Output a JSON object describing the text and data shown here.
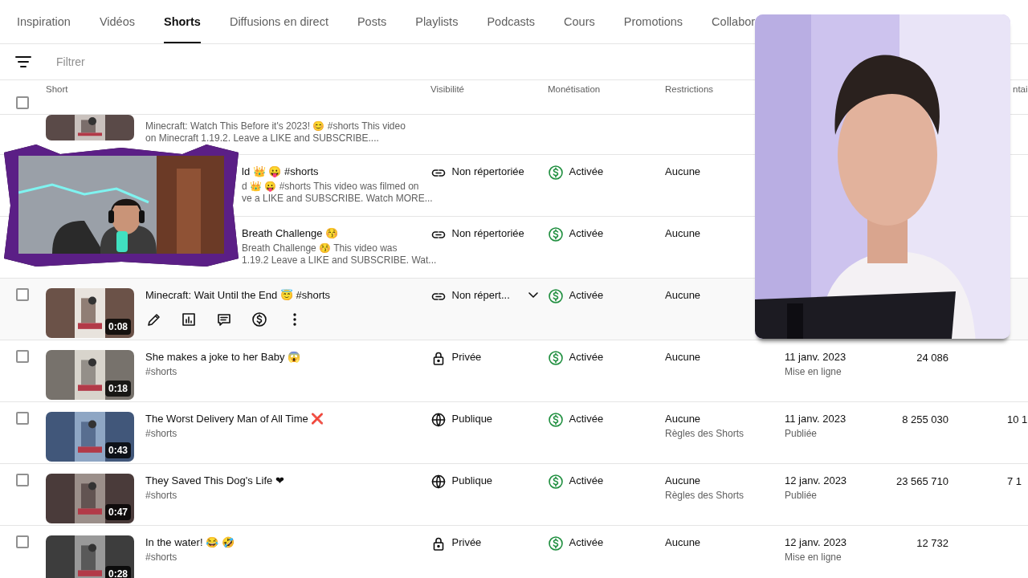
{
  "tabs": [
    {
      "label": "Inspiration",
      "selected": false
    },
    {
      "label": "Vidéos",
      "selected": false
    },
    {
      "label": "Shorts",
      "selected": true
    },
    {
      "label": "Diffusions en direct",
      "selected": false
    },
    {
      "label": "Posts",
      "selected": false
    },
    {
      "label": "Playlists",
      "selected": false
    },
    {
      "label": "Podcasts",
      "selected": false
    },
    {
      "label": "Cours",
      "selected": false
    },
    {
      "label": "Promotions",
      "selected": false
    },
    {
      "label": "Collabor",
      "selected": false
    }
  ],
  "filter": {
    "placeholder": "Filtrer"
  },
  "table": {
    "header": {
      "checked": false,
      "columns": [
        "Short",
        "Visibilité",
        "Monétisation",
        "Restrictions",
        "ntai"
      ]
    },
    "rows": [
      {
        "kind": "clipped",
        "description_lines": [
          "Minecraft: Watch This Before it's 2023! 😊 #shorts This video",
          "on Minecraft 1.19.2. Leave a LIKE and SUBSCRIBE...."
        ]
      },
      {
        "kind": "covered",
        "title": "ld 👑 😛 #shorts",
        "description_lines": [
          "d 👑 😛 #shorts This video was filmed on",
          "ve a LIKE and SUBSCRIBE. Watch MORE..."
        ],
        "visibility": {
          "kind": "unlisted",
          "label": "Non répertoriée"
        },
        "monetization": "Activée",
        "restrictions": "Aucune"
      },
      {
        "kind": "covered",
        "title": "Breath Challenge 😚",
        "description_lines": [
          "Breath Challenge 😚 This video was",
          "1.19.2 Leave a LIKE and SUBSCRIBE. Wat..."
        ],
        "visibility": {
          "kind": "unlisted",
          "label": "Non répertoriée"
        },
        "monetization": "Activée",
        "restrictions": "Aucune"
      },
      {
        "kind": "full",
        "checked": false,
        "hovered": true,
        "duration": "0:08",
        "title": "Minecraft: Wait Until the End 😇 #shorts",
        "visibility": {
          "kind": "unlisted",
          "label": "Non répert..."
        },
        "monetization": "Activée",
        "restrictions": "Aucune"
      },
      {
        "kind": "full",
        "checked": false,
        "hovered": false,
        "duration": "0:18",
        "title": "She makes a joke to her Baby 😱",
        "description": "#shorts",
        "visibility": {
          "kind": "private",
          "label": "Privée"
        },
        "monetization": "Activée",
        "restrictions": "Aucune",
        "date": "11 janv. 2023",
        "date_status": "Mise en ligne",
        "views": "24 086"
      },
      {
        "kind": "full",
        "checked": false,
        "hovered": false,
        "duration": "0:43",
        "title": "The Worst Delivery Man of All Time ❌",
        "description": "#shorts",
        "visibility": {
          "kind": "public",
          "label": "Publique"
        },
        "monetization": "Activée",
        "restrictions": "Aucune",
        "restriction_note": "Règles des Shorts",
        "date": "11 janv. 2023",
        "date_status": "Publiée",
        "views": "8 255 030",
        "comments": "10 1"
      },
      {
        "kind": "full",
        "checked": false,
        "hovered": false,
        "duration": "0:47",
        "title": "They Saved This Dog's Life ❤",
        "description": "#shorts",
        "visibility": {
          "kind": "public",
          "label": "Publique"
        },
        "monetization": "Activée",
        "restrictions": "Aucune",
        "restriction_note": "Règles des Shorts",
        "date": "12 janv. 2023",
        "date_status": "Publiée",
        "views": "23 565 710",
        "comments": "7 1"
      },
      {
        "kind": "full",
        "checked": false,
        "hovered": false,
        "duration": "0:28",
        "title": "In the water! 😂 🤣",
        "description": "#shorts",
        "visibility": {
          "kind": "private",
          "label": "Privée"
        },
        "monetization": "Activée",
        "restrictions": "Aucune",
        "date": "12 janv. 2023",
        "date_status": "Mise en ligne",
        "views": "12 732"
      }
    ]
  }
}
